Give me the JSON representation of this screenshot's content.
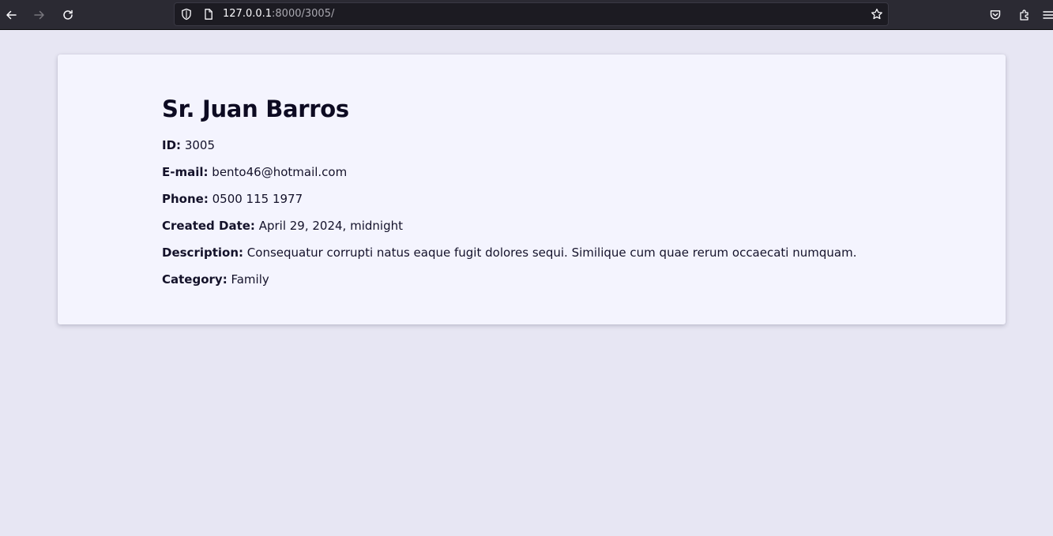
{
  "browser": {
    "url_host": "127.0.0.1",
    "url_rest": ":8000/3005/",
    "icons": [
      "back-arrow-icon",
      "forward-arrow-icon",
      "reload-icon",
      "shield-icon",
      "page-icon",
      "star-icon",
      "pocket-icon",
      "extensions-icon",
      "menu-icon"
    ]
  },
  "contact": {
    "name": "Sr. Juan Barros",
    "fields": [
      {
        "label": "ID:",
        "value": "3005"
      },
      {
        "label": "E-mail:",
        "value": "bento46@hotmail.com"
      },
      {
        "label": "Phone:",
        "value": "0500 115 1977"
      },
      {
        "label": "Created Date:",
        "value": "April 29, 2024, midnight"
      },
      {
        "label": "Description:",
        "value": "Consequatur corrupti natus eaque fugit dolores sequi. Similique cum quae rerum occaecati numquam."
      },
      {
        "label": "Category:",
        "value": "Family"
      }
    ]
  },
  "colors": {
    "page_bg": "#e7e6f3",
    "card_bg": "#f4f4fe",
    "toolbar_bg": "#2b2a33",
    "text": "#0d0b22"
  }
}
